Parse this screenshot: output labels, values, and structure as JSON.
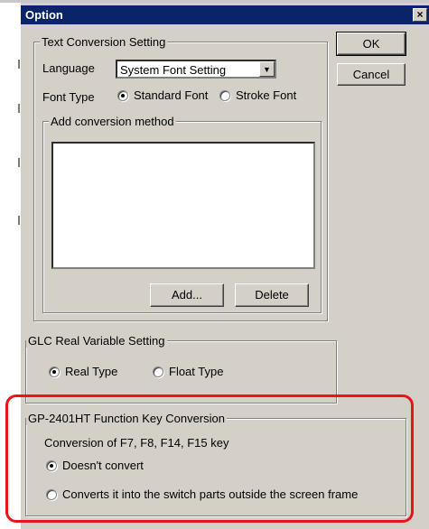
{
  "dialog": {
    "title": "Option",
    "close_glyph": "×",
    "ok_label": "OK",
    "cancel_label": "Cancel"
  },
  "text_conversion": {
    "group_label": "Text Conversion Setting",
    "language_label": "Language",
    "language_value": "System Font Setting",
    "dropdown_glyph": "▼",
    "font_type_label": "Font Type",
    "standard_font": "Standard Font",
    "stroke_font": "Stroke Font",
    "selected_font": "Standard Font",
    "add_method_label": "Add conversion method",
    "add_button": "Add...",
    "delete_button": "Delete"
  },
  "glc": {
    "group_label": "GLC Real Variable Setting",
    "real_type": "Real Type",
    "float_type": "Float Type",
    "selected": "Real Type"
  },
  "gp2401": {
    "group_label": "GP-2401HT Function Key Conversion",
    "description": "Conversion of F7, F8, F14, F15 key",
    "option_no_convert": "Doesn't convert",
    "option_convert": "Converts it into the switch parts outside the screen frame",
    "selected": "Doesn't convert"
  },
  "colors": {
    "titlebar": "#0a246a",
    "dialog_bg": "#d4d0c8",
    "highlight": "#e8131b"
  }
}
